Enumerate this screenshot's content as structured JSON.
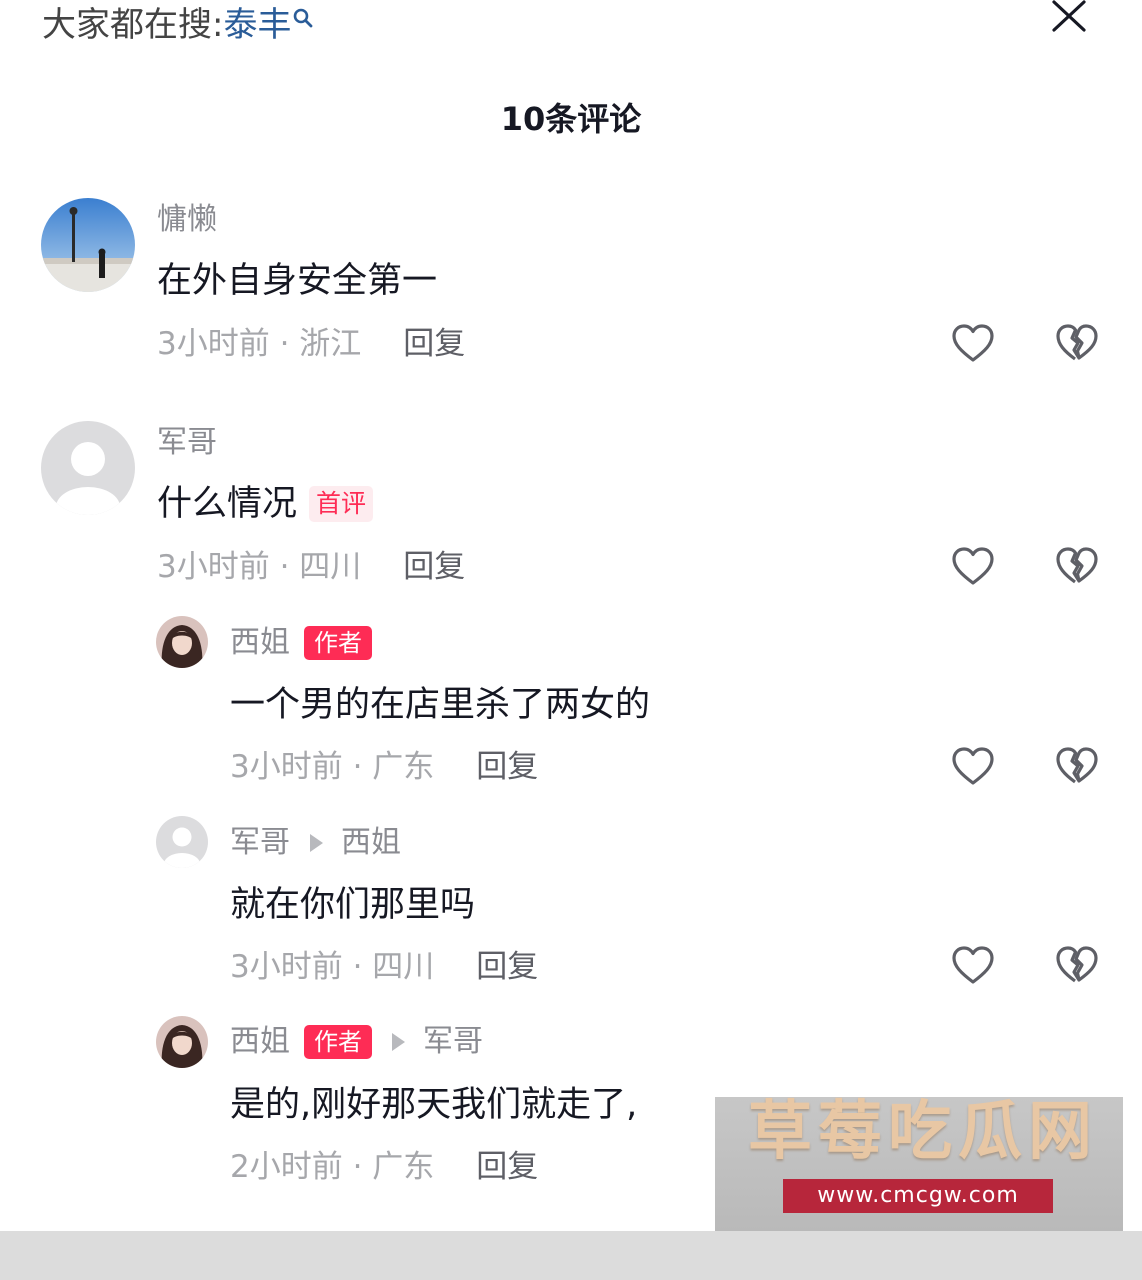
{
  "header": {
    "search_prefix": "大家都在搜:",
    "search_keyword": "泰丰",
    "comment_count_title": "10条评论"
  },
  "comments": [
    {
      "user": "慵懒",
      "text": "在外自身安全第一",
      "time_location": "3小时前 · 浙江",
      "reply": "回复"
    },
    {
      "user": "军哥",
      "text": "什么情况",
      "badge": "首评",
      "time_location": "3小时前 · 四川",
      "reply": "回复"
    },
    {
      "user": "西姐",
      "author_badge": "作者",
      "text": "一个男的在店里杀了两女的",
      "time_location": "3小时前 · 广东",
      "reply": "回复"
    },
    {
      "user": "军哥",
      "reply_to": "西姐",
      "text": "就在你们那里吗",
      "time_location": "3小时前 · 四川",
      "reply": "回复"
    },
    {
      "user": "西姐",
      "author_badge": "作者",
      "reply_to": "军哥",
      "text": "是的,刚好那天我们就走了,",
      "time_location": "2小时前 · 广东",
      "reply": "回复"
    }
  ],
  "watermark": {
    "title": "草莓吃瓜网",
    "url": "www.cmcgw.com"
  },
  "colors": {
    "accent": "#fe2c55",
    "keyword": "#2a5c98",
    "secondary_text": "#8a8b91"
  },
  "icons": {
    "search": "search-icon",
    "close": "close-icon",
    "like": "heart-icon",
    "dislike": "broken-heart-icon"
  }
}
